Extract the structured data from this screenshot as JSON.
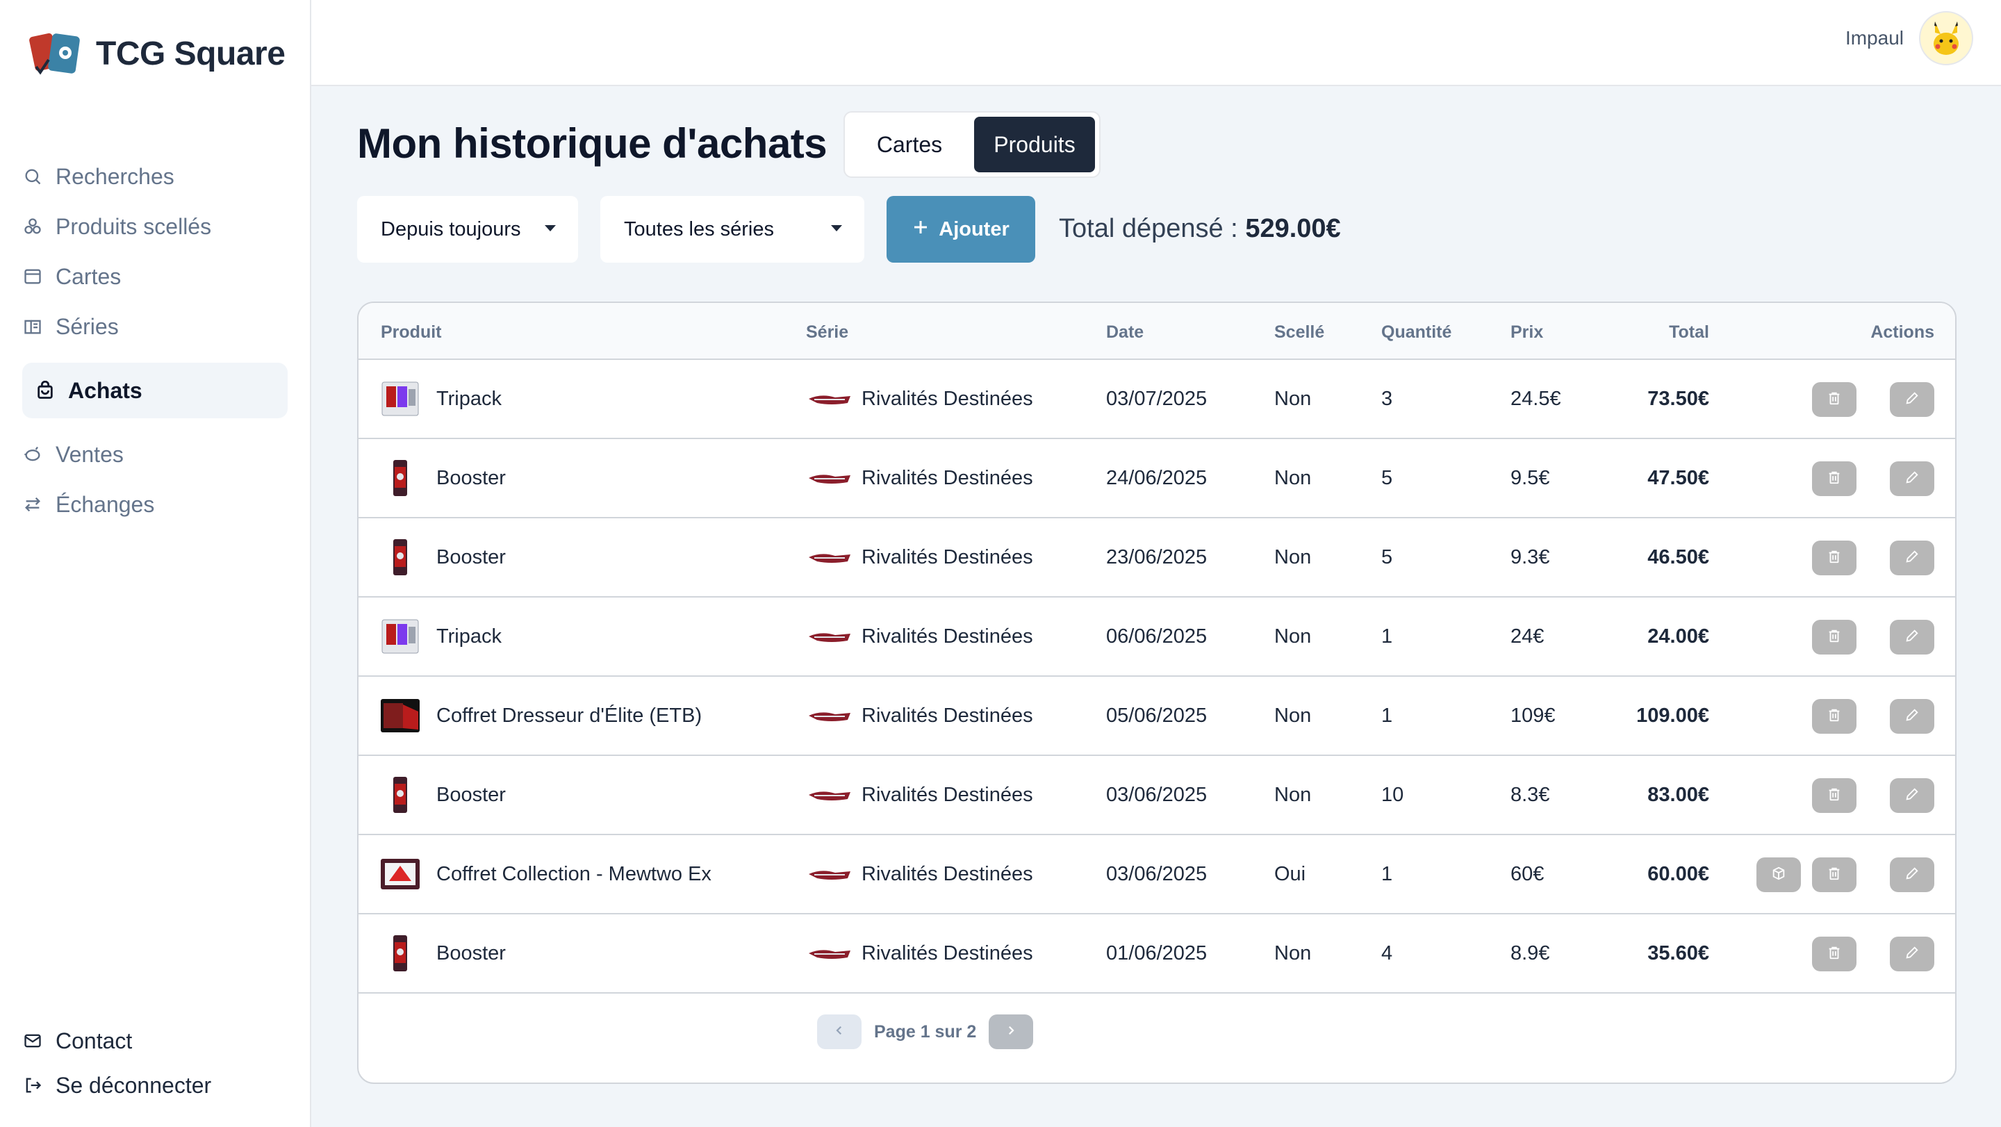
{
  "app": {
    "name": "TCG Square"
  },
  "sidebar": {
    "items": [
      {
        "label": "Recherches",
        "icon": "search-icon"
      },
      {
        "label": "Produits scellés",
        "icon": "boxes-icon"
      },
      {
        "label": "Cartes",
        "icon": "card-icon"
      },
      {
        "label": "Séries",
        "icon": "book-icon"
      },
      {
        "label": "Achats",
        "icon": "bag-icon",
        "active": true
      },
      {
        "label": "Ventes",
        "icon": "piggy-icon"
      },
      {
        "label": "Échanges",
        "icon": "swap-icon"
      }
    ],
    "bottom": [
      {
        "label": "Contact",
        "icon": "mail-icon"
      },
      {
        "label": "Se déconnecter",
        "icon": "logout-icon"
      }
    ]
  },
  "header": {
    "user_name": "Impaul"
  },
  "main": {
    "title": "Mon historique d'achats",
    "tabs": [
      {
        "label": "Cartes",
        "selected": false
      },
      {
        "label": "Produits",
        "selected": true
      }
    ],
    "filters": {
      "period": "Depuis toujours",
      "series": "Toutes les séries"
    },
    "add_label": "Ajouter",
    "total_label": "Total dépensé :",
    "total_value": "529.00€"
  },
  "table": {
    "columns": [
      "Produit",
      "Série",
      "Date",
      "Scellé",
      "Quantité",
      "Prix",
      "Total",
      "Actions"
    ],
    "rows": [
      {
        "product": "Tripack",
        "thumb": "tripack",
        "series": "Rivalités Destinées",
        "date": "03/07/2025",
        "sealed": "Non",
        "qty": "3",
        "price": "24.5€",
        "total": "73.50€"
      },
      {
        "product": "Booster",
        "thumb": "booster",
        "series": "Rivalités Destinées",
        "date": "24/06/2025",
        "sealed": "Non",
        "qty": "5",
        "price": "9.5€",
        "total": "47.50€"
      },
      {
        "product": "Booster",
        "thumb": "booster",
        "series": "Rivalités Destinées",
        "date": "23/06/2025",
        "sealed": "Non",
        "qty": "5",
        "price": "9.3€",
        "total": "46.50€"
      },
      {
        "product": "Tripack",
        "thumb": "tripack",
        "series": "Rivalités Destinées",
        "date": "06/06/2025",
        "sealed": "Non",
        "qty": "1",
        "price": "24€",
        "total": "24.00€"
      },
      {
        "product": "Coffret Dresseur d'Élite (ETB)",
        "thumb": "etb",
        "series": "Rivalités Destinées",
        "date": "05/06/2025",
        "sealed": "Non",
        "qty": "1",
        "price": "109€",
        "total": "109.00€"
      },
      {
        "product": "Booster",
        "thumb": "booster",
        "series": "Rivalités Destinées",
        "date": "03/06/2025",
        "sealed": "Non",
        "qty": "10",
        "price": "8.3€",
        "total": "83.00€"
      },
      {
        "product": "Coffret Collection - Mewtwo Ex",
        "thumb": "coffret",
        "series": "Rivalités Destinées",
        "date": "03/06/2025",
        "sealed": "Oui",
        "qty": "1",
        "price": "60€",
        "total": "60.00€",
        "extra_action": true
      },
      {
        "product": "Booster",
        "thumb": "booster",
        "series": "Rivalités Destinées",
        "date": "01/06/2025",
        "sealed": "Non",
        "qty": "4",
        "price": "8.9€",
        "total": "35.60€"
      }
    ]
  },
  "pagination": {
    "label": "Page 1 sur 2"
  },
  "colors": {
    "accent": "#4a90b8",
    "dark": "#1e293b",
    "action_button": "#b7b7b7"
  }
}
